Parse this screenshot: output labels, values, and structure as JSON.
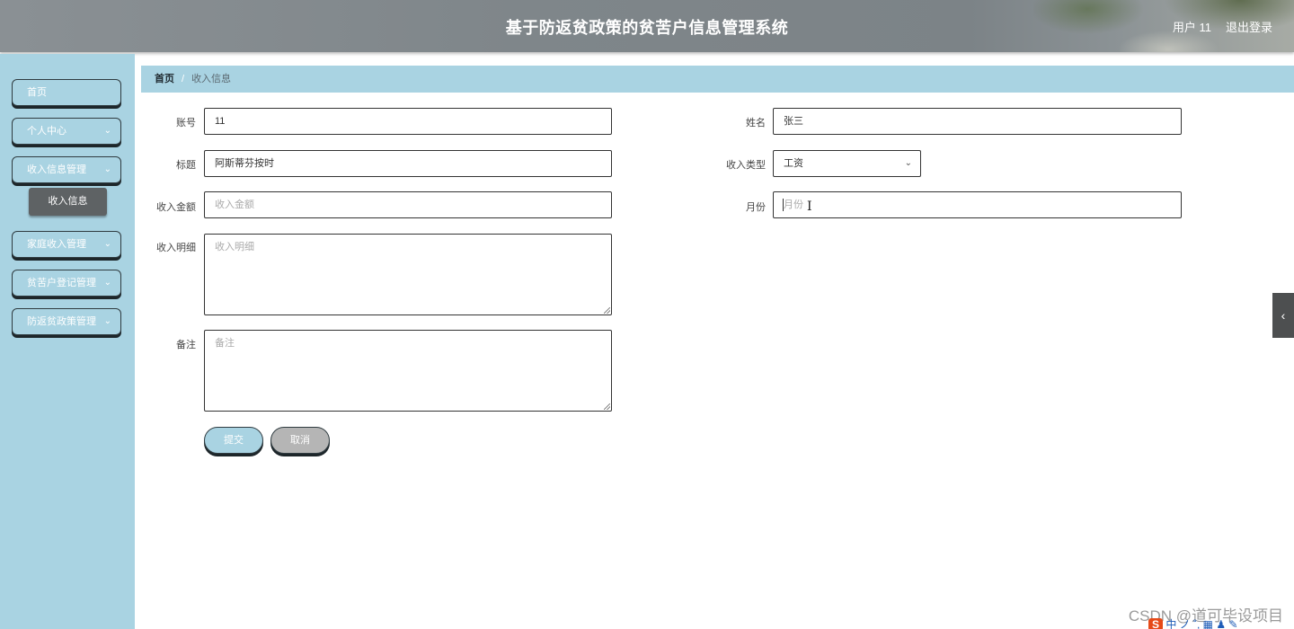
{
  "header": {
    "title": "基于防返贫政策的贫苦户信息管理系统",
    "user_label": "用户 11",
    "logout_label": "退出登录"
  },
  "sidebar": {
    "items": [
      {
        "label": "首页"
      },
      {
        "label": "个人中心"
      },
      {
        "label": "收入信息管理"
      },
      {
        "label": "家庭收入管理"
      },
      {
        "label": "贫苦户登记管理"
      },
      {
        "label": "防返贫政策管理"
      }
    ],
    "active_sub": "收入信息"
  },
  "breadcrumb": {
    "home": "首页",
    "separator": "/",
    "current": "收入信息"
  },
  "form": {
    "account": {
      "label": "账号",
      "value": "11"
    },
    "name": {
      "label": "姓名",
      "value": "张三"
    },
    "title": {
      "label": "标题",
      "value": "阿斯蒂芬按时"
    },
    "income_type": {
      "label": "收入类型",
      "value": "工资"
    },
    "income_amount": {
      "label": "收入金额",
      "placeholder": "收入金额"
    },
    "month": {
      "label": "月份",
      "placeholder": "月份"
    },
    "income_detail": {
      "label": "收入明细",
      "placeholder": "收入明细"
    },
    "remark": {
      "label": "备注",
      "placeholder": "备注"
    },
    "submit_label": "提交",
    "cancel_label": "取消"
  },
  "watermark": "CSDN @道可毕设项目",
  "ime": {
    "logo": "S",
    "text": "中 ノ ˚, ▦ ♟ ✎"
  },
  "icons": {
    "chevron": "chevron-down-icon",
    "collapse": "chevron-left-icon"
  },
  "colors": {
    "accent": "#a9d3e2",
    "header": "#7f868a",
    "active_sub": "#5e6264"
  }
}
